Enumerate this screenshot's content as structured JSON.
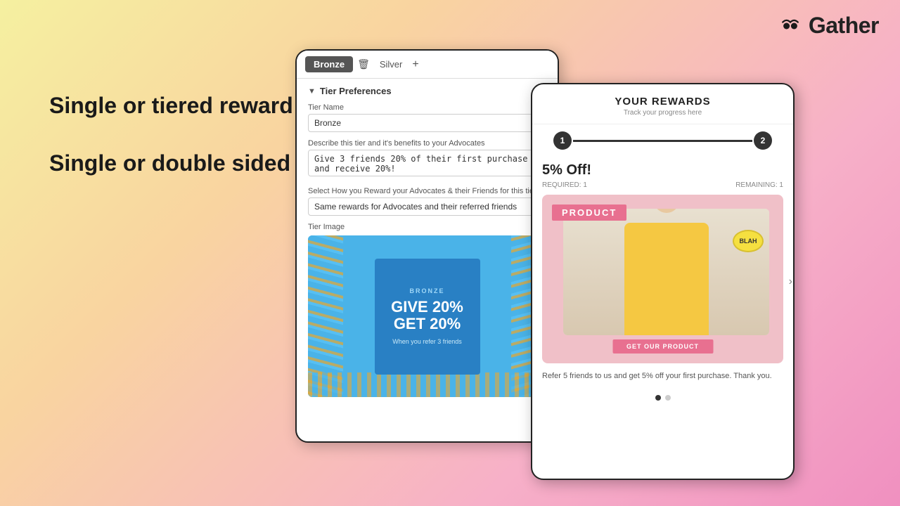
{
  "logo": {
    "text": "Gather"
  },
  "left_text": {
    "heading1": "Single  or tiered reward structures",
    "heading2": "Single or double sided referral programs"
  },
  "tablet_left": {
    "tabs": [
      "Bronze",
      "Silver"
    ],
    "tab_active": "Bronze",
    "tier_prefs_label": "Tier Preferences",
    "tier_name_label": "Tier Name",
    "tier_name_value": "Bronze",
    "describe_label": "Describe this tier and it's benefits to your Advocates",
    "describe_value": "Give 3 friends 20% of their first purchase and receive 20%!",
    "select_label": "Select How you Reward your Advocates & their Friends for this tier",
    "select_value": "Same rewards for Advocates and their referred friends",
    "tier_image_label": "Tier Image",
    "bronze_card": {
      "tier_label": "BRONZE",
      "headline": "GIVE 20%\nGET 20%",
      "subtext": "When you refer 3 friends"
    }
  },
  "tablet_right": {
    "title": "YOUR REWARDS",
    "subtitle": "Track your progress here",
    "progress_step1": "1",
    "progress_step2": "2",
    "reward_off": "5% Off!",
    "required_label": "REQUIRED: 1",
    "remaining_label": "REMAINING: 1",
    "product_label": "PRODUCT",
    "blah_text": "BLAH",
    "cta_button": "GET OUR PRODUCT",
    "reward_desc": "Refer 5 friends to us and get 5% off your first purchase. Thank you.",
    "chevron": "›"
  }
}
